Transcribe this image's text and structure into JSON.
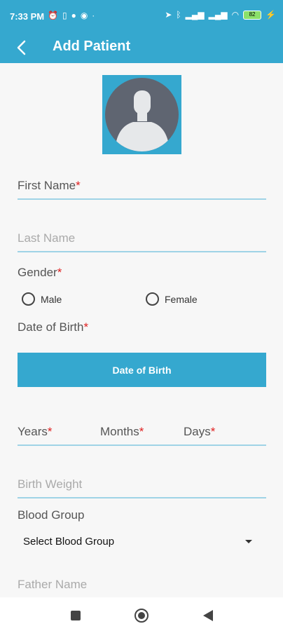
{
  "status": {
    "time": "7:33 PM",
    "battery": "82"
  },
  "header": {
    "title": "Add Patient"
  },
  "form": {
    "first_name": {
      "label": "First Name",
      "required": "*"
    },
    "last_name": {
      "placeholder": "Last Name"
    },
    "gender": {
      "label": "Gender",
      "required": "*",
      "options": [
        "Male",
        "Female"
      ]
    },
    "dob": {
      "label": "Date of Birth",
      "required": "*",
      "button_label": "Date of Birth"
    },
    "age": {
      "years": "Years",
      "months": "Months",
      "days": "Days",
      "required": "*"
    },
    "birth_weight": {
      "placeholder": "Birth Weight"
    },
    "blood_group": {
      "label": "Blood Group",
      "selected": "Select Blood Group"
    },
    "father_name": {
      "placeholder": "Father Name"
    }
  },
  "colors": {
    "accent": "#35a8cf",
    "required": "#e02020"
  }
}
